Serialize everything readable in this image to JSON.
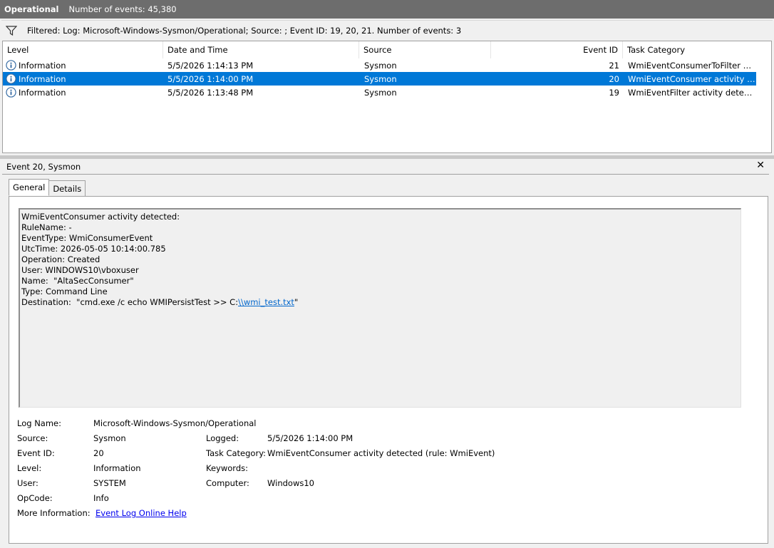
{
  "titlebar": {
    "log_name": "Operational",
    "event_count": "Number of events: 45,380"
  },
  "filter": {
    "icon": "filter-icon",
    "text": "Filtered: Log: Microsoft-Windows-Sysmon/Operational; Source: ; Event ID: 19, 20, 21. Number of events: 3"
  },
  "list": {
    "columns": [
      "Level",
      "Date and Time",
      "Source",
      "Event ID",
      "Task Category"
    ],
    "rows": [
      {
        "level": "Information",
        "datetime": "5/5/2026 1:14:13 PM",
        "source": "Sysmon",
        "event_id": "21",
        "task": "WmiEventConsumerToFilter act...",
        "selected": false
      },
      {
        "level": "Information",
        "datetime": "5/5/2026 1:14:00 PM",
        "source": "Sysmon",
        "event_id": "20",
        "task": "WmiEventConsumer activity dete...",
        "selected": true
      },
      {
        "level": "Information",
        "datetime": "5/5/2026 1:13:48 PM",
        "source": "Sysmon",
        "event_id": "19",
        "task": "WmiEventFilter activity detecte...",
        "selected": false
      }
    ]
  },
  "detail": {
    "header": "Event 20, Sysmon",
    "close_label": "✕",
    "tabs": [
      "General",
      "Details"
    ],
    "message": {
      "lines": [
        "WmiEventConsumer activity detected:",
        "RuleName: -",
        "EventType: WmiConsumerEvent",
        "UtcTime: 2026-05-05 10:14:00.785",
        "Operation: Created",
        "User: WINDOWS10\\vboxuser",
        "Name:  \"AltaSecConsumer\"",
        "Type: Command Line"
      ],
      "destination_prefix": "Destination:  \"cmd.exe /c echo WMIPersistTest >> C:",
      "destination_link": "\\\\wmi_test.txt",
      "destination_suffix": "\""
    },
    "props": {
      "log_name_label": "Log Name:",
      "log_name": "Microsoft-Windows-Sysmon/Operational",
      "source_label": "Source:",
      "source": "Sysmon",
      "logged_label": "Logged:",
      "logged": "5/5/2026 1:14:00 PM",
      "event_id_label": "Event ID:",
      "event_id": "20",
      "task_label": "Task Category:",
      "task": "WmiEventConsumer activity detected (rule: WmiEvent)",
      "level_label": "Level:",
      "level": "Information",
      "keywords_label": "Keywords:",
      "keywords": "",
      "user_label": "User:",
      "user": "SYSTEM",
      "computer_label": "Computer:",
      "computer": "Windows10",
      "opcode_label": "OpCode:",
      "opcode": "Info",
      "more_info_label": "More Information:",
      "more_info_link": "Event Log Online Help"
    }
  },
  "colors": {
    "selection": "#0078d7",
    "titlebar": "#6d6d6d",
    "link": "#0066cc",
    "info_icon": "#3a6ea5"
  }
}
